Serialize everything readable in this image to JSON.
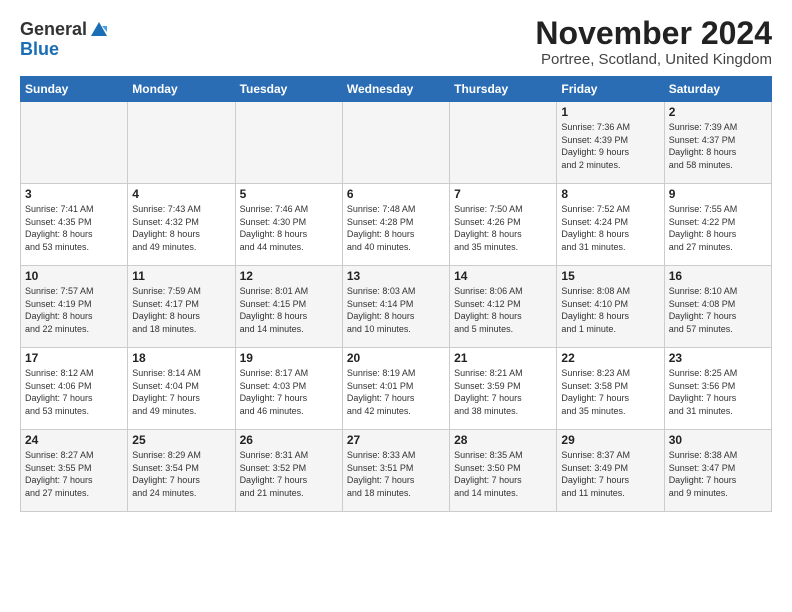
{
  "header": {
    "logo_general": "General",
    "logo_blue": "Blue",
    "month_title": "November 2024",
    "subtitle": "Portree, Scotland, United Kingdom"
  },
  "weekdays": [
    "Sunday",
    "Monday",
    "Tuesday",
    "Wednesday",
    "Thursday",
    "Friday",
    "Saturday"
  ],
  "weeks": [
    [
      {
        "day": "",
        "info": ""
      },
      {
        "day": "",
        "info": ""
      },
      {
        "day": "",
        "info": ""
      },
      {
        "day": "",
        "info": ""
      },
      {
        "day": "",
        "info": ""
      },
      {
        "day": "1",
        "info": "Sunrise: 7:36 AM\nSunset: 4:39 PM\nDaylight: 9 hours\nand 2 minutes."
      },
      {
        "day": "2",
        "info": "Sunrise: 7:39 AM\nSunset: 4:37 PM\nDaylight: 8 hours\nand 58 minutes."
      }
    ],
    [
      {
        "day": "3",
        "info": "Sunrise: 7:41 AM\nSunset: 4:35 PM\nDaylight: 8 hours\nand 53 minutes."
      },
      {
        "day": "4",
        "info": "Sunrise: 7:43 AM\nSunset: 4:32 PM\nDaylight: 8 hours\nand 49 minutes."
      },
      {
        "day": "5",
        "info": "Sunrise: 7:46 AM\nSunset: 4:30 PM\nDaylight: 8 hours\nand 44 minutes."
      },
      {
        "day": "6",
        "info": "Sunrise: 7:48 AM\nSunset: 4:28 PM\nDaylight: 8 hours\nand 40 minutes."
      },
      {
        "day": "7",
        "info": "Sunrise: 7:50 AM\nSunset: 4:26 PM\nDaylight: 8 hours\nand 35 minutes."
      },
      {
        "day": "8",
        "info": "Sunrise: 7:52 AM\nSunset: 4:24 PM\nDaylight: 8 hours\nand 31 minutes."
      },
      {
        "day": "9",
        "info": "Sunrise: 7:55 AM\nSunset: 4:22 PM\nDaylight: 8 hours\nand 27 minutes."
      }
    ],
    [
      {
        "day": "10",
        "info": "Sunrise: 7:57 AM\nSunset: 4:19 PM\nDaylight: 8 hours\nand 22 minutes."
      },
      {
        "day": "11",
        "info": "Sunrise: 7:59 AM\nSunset: 4:17 PM\nDaylight: 8 hours\nand 18 minutes."
      },
      {
        "day": "12",
        "info": "Sunrise: 8:01 AM\nSunset: 4:15 PM\nDaylight: 8 hours\nand 14 minutes."
      },
      {
        "day": "13",
        "info": "Sunrise: 8:03 AM\nSunset: 4:14 PM\nDaylight: 8 hours\nand 10 minutes."
      },
      {
        "day": "14",
        "info": "Sunrise: 8:06 AM\nSunset: 4:12 PM\nDaylight: 8 hours\nand 5 minutes."
      },
      {
        "day": "15",
        "info": "Sunrise: 8:08 AM\nSunset: 4:10 PM\nDaylight: 8 hours\nand 1 minute."
      },
      {
        "day": "16",
        "info": "Sunrise: 8:10 AM\nSunset: 4:08 PM\nDaylight: 7 hours\nand 57 minutes."
      }
    ],
    [
      {
        "day": "17",
        "info": "Sunrise: 8:12 AM\nSunset: 4:06 PM\nDaylight: 7 hours\nand 53 minutes."
      },
      {
        "day": "18",
        "info": "Sunrise: 8:14 AM\nSunset: 4:04 PM\nDaylight: 7 hours\nand 49 minutes."
      },
      {
        "day": "19",
        "info": "Sunrise: 8:17 AM\nSunset: 4:03 PM\nDaylight: 7 hours\nand 46 minutes."
      },
      {
        "day": "20",
        "info": "Sunrise: 8:19 AM\nSunset: 4:01 PM\nDaylight: 7 hours\nand 42 minutes."
      },
      {
        "day": "21",
        "info": "Sunrise: 8:21 AM\nSunset: 3:59 PM\nDaylight: 7 hours\nand 38 minutes."
      },
      {
        "day": "22",
        "info": "Sunrise: 8:23 AM\nSunset: 3:58 PM\nDaylight: 7 hours\nand 35 minutes."
      },
      {
        "day": "23",
        "info": "Sunrise: 8:25 AM\nSunset: 3:56 PM\nDaylight: 7 hours\nand 31 minutes."
      }
    ],
    [
      {
        "day": "24",
        "info": "Sunrise: 8:27 AM\nSunset: 3:55 PM\nDaylight: 7 hours\nand 27 minutes."
      },
      {
        "day": "25",
        "info": "Sunrise: 8:29 AM\nSunset: 3:54 PM\nDaylight: 7 hours\nand 24 minutes."
      },
      {
        "day": "26",
        "info": "Sunrise: 8:31 AM\nSunset: 3:52 PM\nDaylight: 7 hours\nand 21 minutes."
      },
      {
        "day": "27",
        "info": "Sunrise: 8:33 AM\nSunset: 3:51 PM\nDaylight: 7 hours\nand 18 minutes."
      },
      {
        "day": "28",
        "info": "Sunrise: 8:35 AM\nSunset: 3:50 PM\nDaylight: 7 hours\nand 14 minutes."
      },
      {
        "day": "29",
        "info": "Sunrise: 8:37 AM\nSunset: 3:49 PM\nDaylight: 7 hours\nand 11 minutes."
      },
      {
        "day": "30",
        "info": "Sunrise: 8:38 AM\nSunset: 3:47 PM\nDaylight: 7 hours\nand 9 minutes."
      }
    ]
  ]
}
